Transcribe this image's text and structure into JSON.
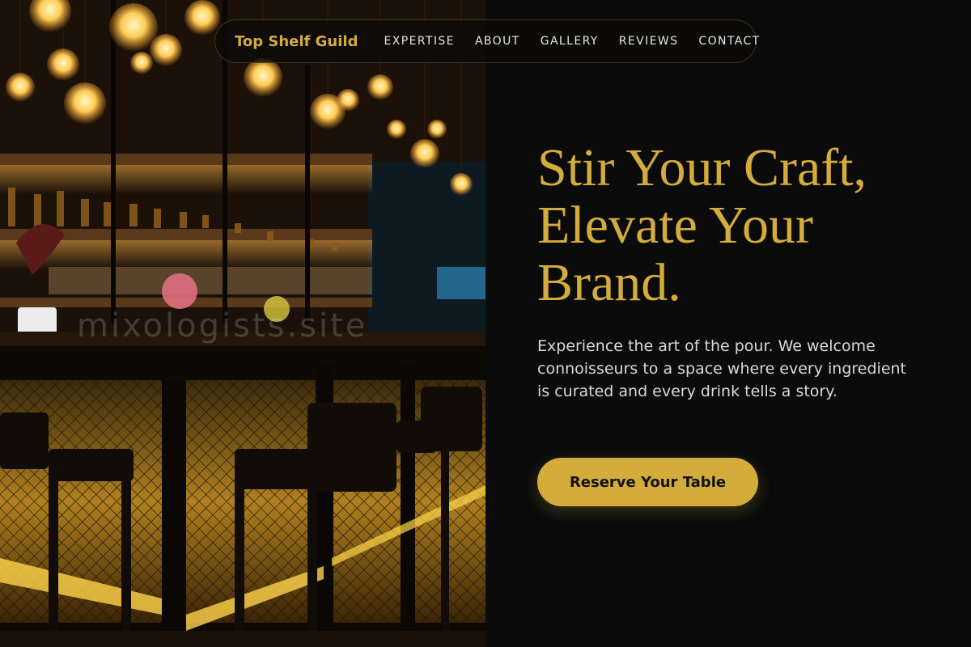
{
  "nav": {
    "brand": "Top Shelf Guild",
    "links": [
      {
        "label": "EXPERTISE"
      },
      {
        "label": "ABOUT"
      },
      {
        "label": "GALLERY"
      },
      {
        "label": "REVIEWS"
      },
      {
        "label": "CONTACT"
      }
    ]
  },
  "hero": {
    "headline_line1": "Stir Your Craft,",
    "headline_line2": "Elevate Your",
    "headline_line3": "Brand.",
    "lead": "Experience the art of the pour. We welcome connoisseurs to a space where every ingredient is curated and every drink tells a story.",
    "cta_label": "Reserve Your Table"
  },
  "photo": {
    "alt": "Bar interior with hanging edison bulbs, bottle shelves and bar stools",
    "watermark": "mixologists.site"
  },
  "colors": {
    "accent": "#d4ac3c",
    "background": "#0b0b0b",
    "body_text": "#d9d9d9"
  }
}
